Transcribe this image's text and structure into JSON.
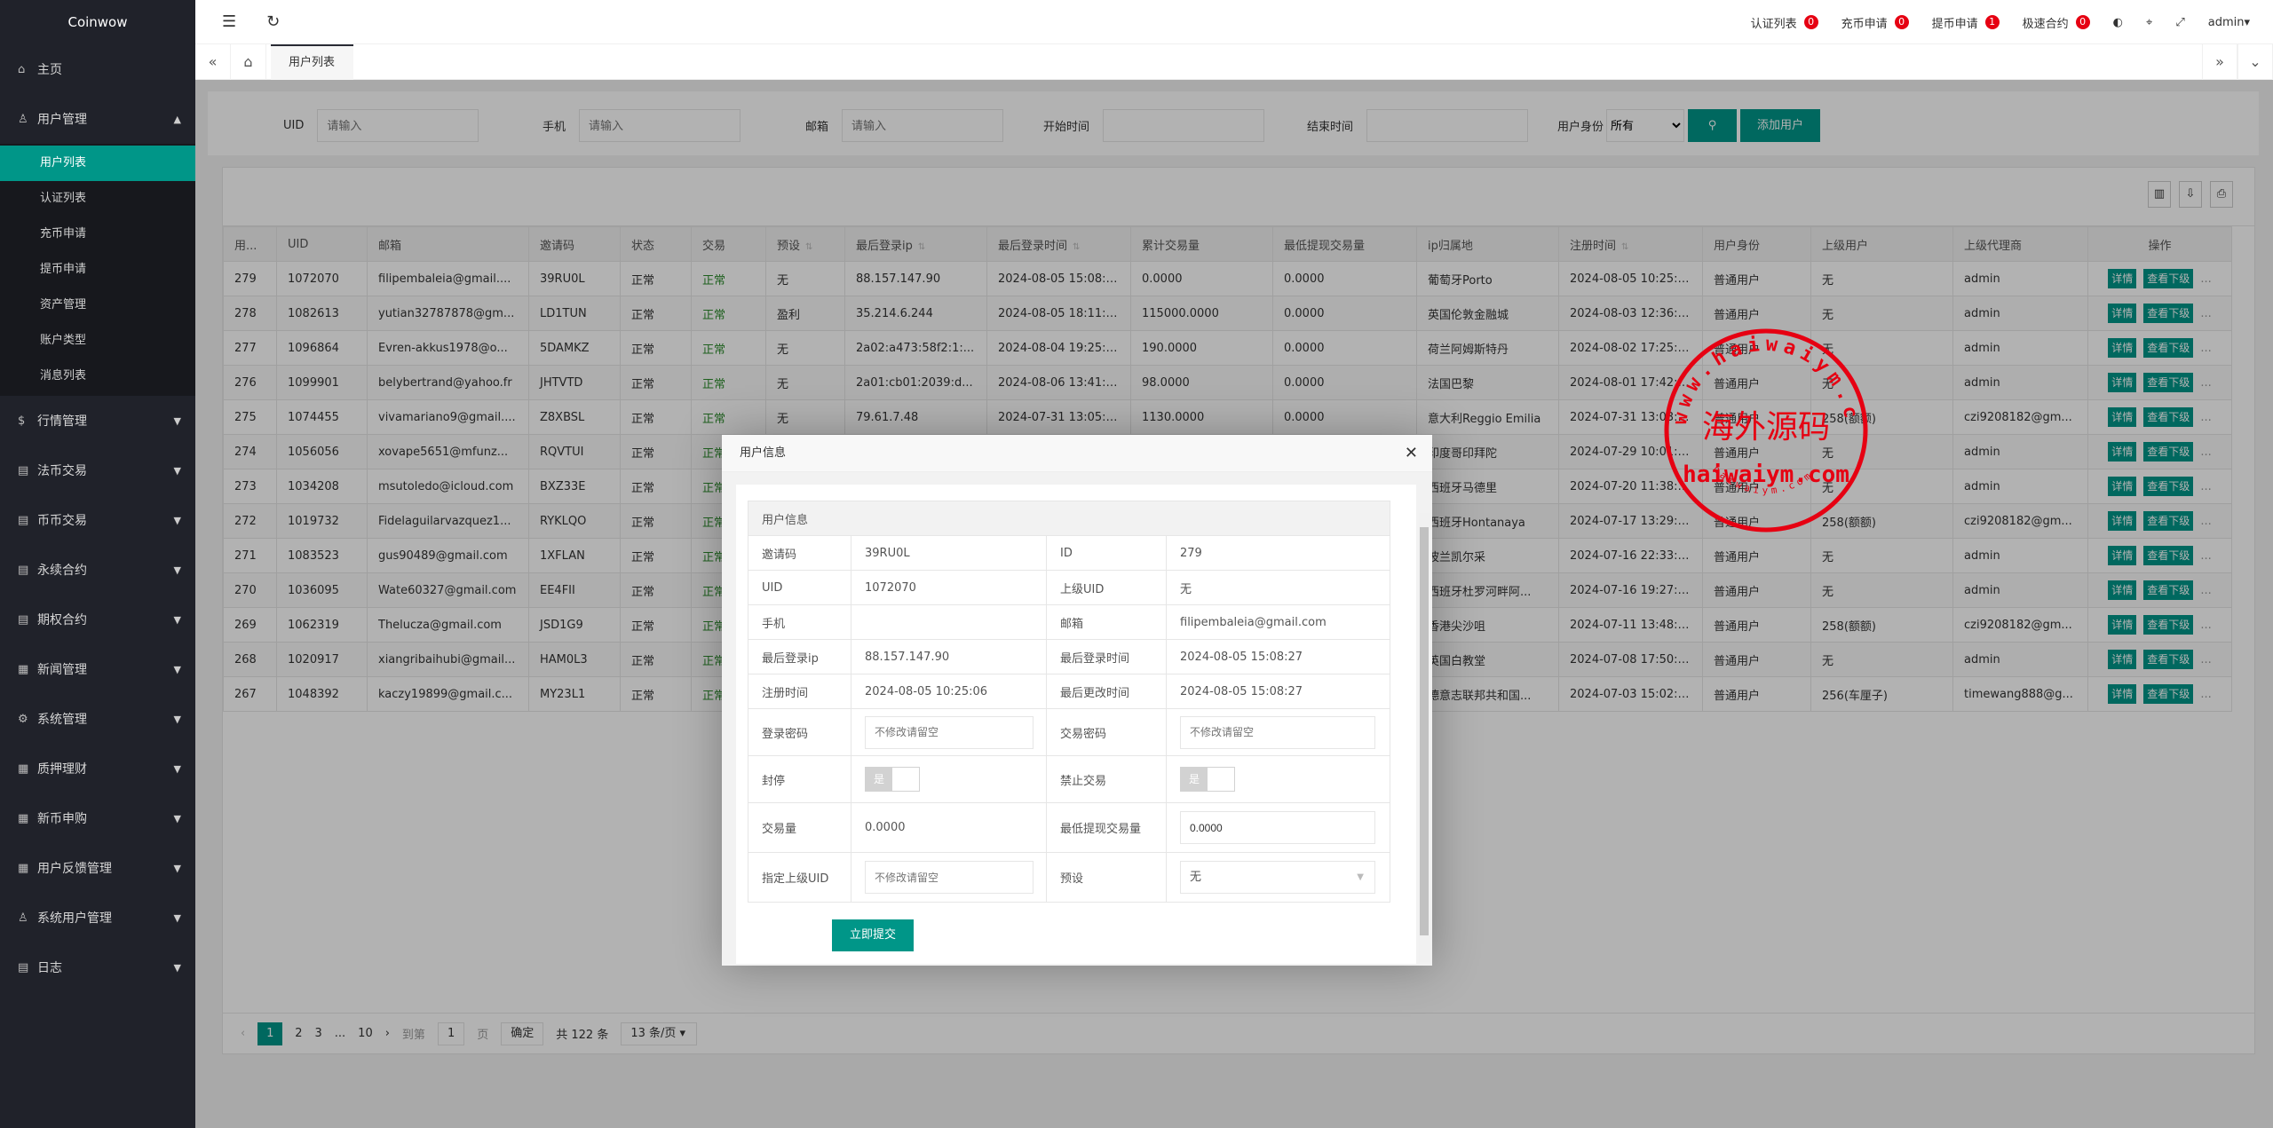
{
  "app": {
    "logo": "Coinwow"
  },
  "sidebar": {
    "home": "主页",
    "user_mgmt": "用户管理",
    "sub": [
      "用户列表",
      "认证列表",
      "充币申请",
      "提币申请",
      "资产管理",
      "账户类型",
      "消息列表"
    ],
    "groups": [
      {
        "label": "行情管理",
        "icon": "dollar-icon"
      },
      {
        "label": "法币交易",
        "icon": "doc-icon"
      },
      {
        "label": "币币交易",
        "icon": "doc-icon"
      },
      {
        "label": "永续合约",
        "icon": "doc-icon"
      },
      {
        "label": "期权合约",
        "icon": "doc-icon"
      },
      {
        "label": "新闻管理",
        "icon": "news-icon"
      },
      {
        "label": "系统管理",
        "icon": "gear-icon"
      },
      {
        "label": "质押理财",
        "icon": "news-icon"
      },
      {
        "label": "新币申购",
        "icon": "news-icon"
      },
      {
        "label": "用户反馈管理",
        "icon": "news-icon"
      },
      {
        "label": "系统用户管理",
        "icon": "users-icon"
      },
      {
        "label": "日志",
        "icon": "doc-icon"
      }
    ]
  },
  "header": {
    "notices": [
      {
        "label": "认证列表",
        "count": "0"
      },
      {
        "label": "充币申请",
        "count": "0"
      },
      {
        "label": "提币申请",
        "count": "1"
      },
      {
        "label": "极速合约",
        "count": "0"
      }
    ],
    "user": "admin"
  },
  "tabs": {
    "active": "用户列表"
  },
  "filter": {
    "uid": "UID",
    "phone": "手机",
    "email": "邮箱",
    "start": "开始时间",
    "end": "结束时间",
    "role": "用户身份",
    "role_value": "所有",
    "placeholder": "请输入",
    "add": "添加用户"
  },
  "table": {
    "headers": [
      "用...",
      "UID",
      "邮箱",
      "邀请码",
      "状态",
      "交易",
      "预设",
      "最后登录ip",
      "最后登录时间",
      "累计交易量",
      "最低提现交易量",
      "ip归属地",
      "注册时间",
      "用户身份",
      "上级用户",
      "上级代理商",
      "操作"
    ],
    "detail": "详情",
    "sub": "查看下级",
    "rows": [
      [
        "279",
        "1072070",
        "filipembaleia@gmail....",
        "39RU0L",
        "正常",
        "正常",
        "无",
        "88.157.147.90",
        "2024-08-05 15:08:27",
        "0.0000",
        "0.0000",
        "葡萄牙Porto",
        "2024-08-05 10:25:06",
        "普通用户",
        "无",
        "admin"
      ],
      [
        "278",
        "1082613",
        "yutian32787878@gm...",
        "LD1TUN",
        "正常",
        "正常",
        "盈利",
        "35.214.6.244",
        "2024-08-05 18:11:03",
        "115000.0000",
        "0.0000",
        "英国伦敦金融城",
        "2024-08-03 12:36:12",
        "普通用户",
        "无",
        "admin"
      ],
      [
        "277",
        "1096864",
        "Evren-akkus1978@o...",
        "5DAMKZ",
        "正常",
        "正常",
        "无",
        "2a02:a473:58f2:1:...",
        "2024-08-04 19:25:21",
        "190.0000",
        "0.0000",
        "荷兰阿姆斯特丹",
        "2024-08-02 17:25:26",
        "普通用户",
        "无",
        "admin"
      ],
      [
        "276",
        "1099901",
        "belybertrand@yahoo.fr",
        "JHTVTD",
        "正常",
        "正常",
        "无",
        "2a01:cb01:2039:d...",
        "2024-08-06 13:41:41",
        "98.0000",
        "0.0000",
        "法国巴黎",
        "2024-08-01 17:42:26",
        "普通用户",
        "无",
        "admin"
      ],
      [
        "275",
        "1074455",
        "vivamariano9@gmail....",
        "Z8XBSL",
        "正常",
        "正常",
        "无",
        "79.61.7.48",
        "2024-07-31 13:05:28",
        "1130.0000",
        "0.0000",
        "意大利Reggio Emilia",
        "2024-07-31 13:03:19",
        "普通用户",
        "258(额额)",
        "czi9208182@gm..."
      ],
      [
        "274",
        "1056056",
        "xovape5651@mfunz...",
        "RQVTUI",
        "正常",
        "正常",
        "",
        "",
        "",
        "",
        "",
        "印度哥印拜陀",
        "2024-07-29 10:01:58",
        "普通用户",
        "无",
        "admin"
      ],
      [
        "273",
        "1034208",
        "msutoledo@icloud.com",
        "BXZ33E",
        "正常",
        "正常",
        "",
        "",
        "",
        "",
        "",
        "西班牙马德里",
        "2024-07-20 11:38:41",
        "普通用户",
        "无",
        "admin"
      ],
      [
        "272",
        "1019732",
        "Fidelaguilarvazquez1...",
        "RYKLQO",
        "正常",
        "正常",
        "",
        "",
        "",
        "",
        "",
        "西班牙Hontanaya",
        "2024-07-17 13:29:17",
        "普通用户",
        "258(额额)",
        "czi9208182@gm..."
      ],
      [
        "271",
        "1083523",
        "gus90489@gmail.com",
        "1XFLAN",
        "正常",
        "正常",
        "",
        "",
        "",
        "",
        "",
        "波兰凯尔采",
        "2024-07-16 22:33:37",
        "普通用户",
        "无",
        "admin"
      ],
      [
        "270",
        "1036095",
        "Wate60327@gmail.com",
        "EE4FII",
        "正常",
        "正常",
        "",
        "",
        "",
        "",
        "",
        "西班牙杜罗河畔阿...",
        "2024-07-16 19:27:28",
        "普通用户",
        "无",
        "admin"
      ],
      [
        "269",
        "1062319",
        "Thelucza@gmail.com",
        "JSD1G9",
        "正常",
        "正常",
        "",
        "",
        "",
        "",
        "",
        "香港尖沙咀",
        "2024-07-11 13:48:05",
        "普通用户",
        "258(额额)",
        "czi9208182@gm..."
      ],
      [
        "268",
        "1020917",
        "xiangribaihubi@gmail...",
        "HAM0L3",
        "正常",
        "正常",
        "",
        "",
        "",
        "",
        "",
        "英国白教堂",
        "2024-07-08 17:50:05",
        "普通用户",
        "无",
        "admin"
      ],
      [
        "267",
        "1048392",
        "kaczy19899@gmail.c...",
        "MY23L1",
        "正常",
        "正常",
        "",
        "",
        "",
        "",
        "",
        "德意志联邦共和国...",
        "2024-07-03 15:02:08",
        "普通用户",
        "256(车厘子)",
        "timewang888@g..."
      ]
    ]
  },
  "pager": {
    "pages": [
      "1",
      "2",
      "3",
      "...",
      "10"
    ],
    "goto": "到第",
    "page_value": "1",
    "page_unit": "页",
    "confirm": "确定",
    "total": "共 122 条",
    "per_page": "13 条/页"
  },
  "modal": {
    "title": "用户信息",
    "section": "用户信息",
    "invite_l": "邀请码",
    "invite": "39RU0L",
    "id_l": "ID",
    "id": "279",
    "uid_l": "UID",
    "uid": "1072070",
    "parent_l": "上级UID",
    "parent": "无",
    "phone_l": "手机",
    "phone": "",
    "email_l": "邮箱",
    "email": "filipembaleia@gmail.com",
    "ip_l": "最后登录ip",
    "ip": "88.157.147.90",
    "login_l": "最后登录时间",
    "login": "2024-08-05 15:08:27",
    "reg_l": "注册时间",
    "reg": "2024-08-05 10:25:06",
    "upd_l": "最后更改时间",
    "upd": "2024-08-05 15:08:27",
    "pwd_l": "登录密码",
    "tpwd_l": "交易密码",
    "pwd_ph": "不修改请留空",
    "ban_l": "封停",
    "notrade_l": "禁止交易",
    "switch_text": "是",
    "vol_l": "交易量",
    "vol": "0.0000",
    "minw_l": "最低提现交易量",
    "minw": "0.0000",
    "setparent_l": "指定上级UID",
    "preset_l": "预设",
    "preset": "无",
    "submit": "立即提交"
  },
  "watermark": {
    "outer": "www.haiwaiym.com",
    "center": "海外源码",
    "inner": "haiwaiym.com",
    "bottom": "haiwaiym.com",
    "color": "#e60012"
  },
  "colors": {
    "primary": "#009688",
    "sidebar": "#20222a",
    "badge": "#e60012"
  }
}
